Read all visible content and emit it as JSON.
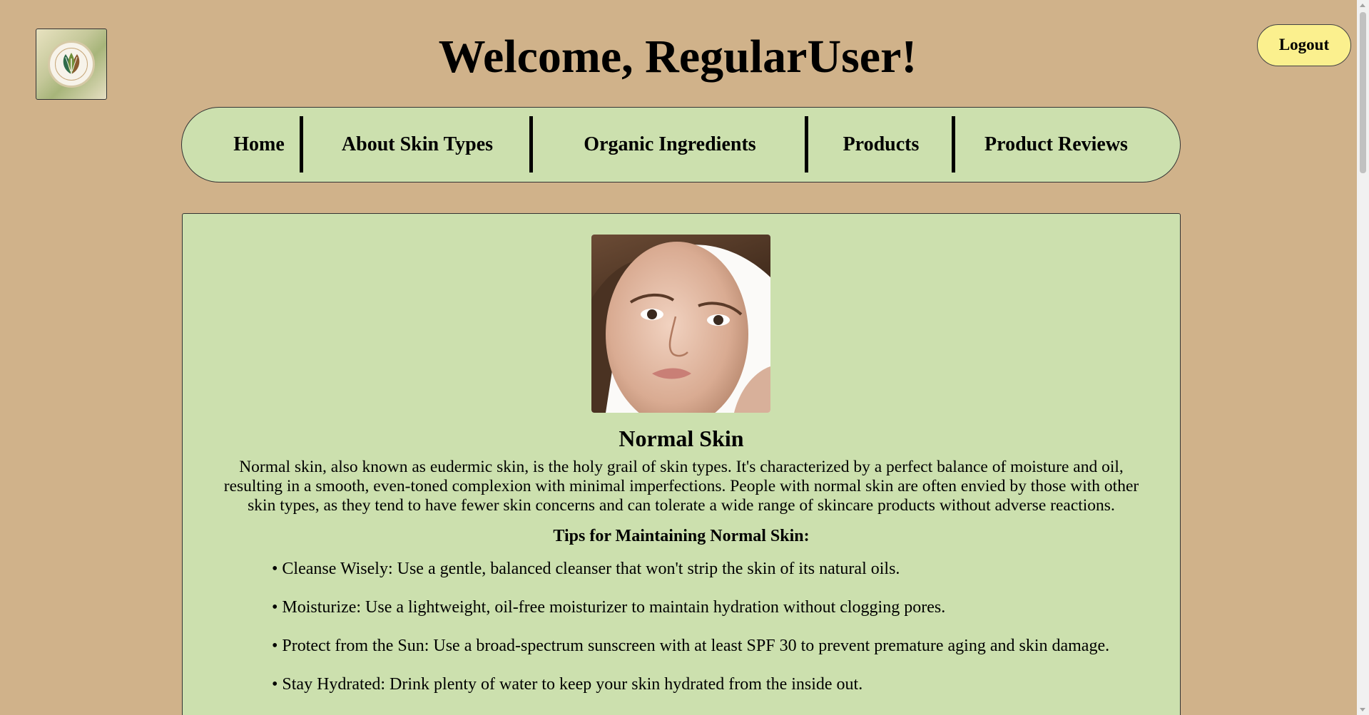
{
  "header": {
    "welcome": "Welcome, RegularUser!",
    "logout_label": "Logout",
    "logo_icon": "leaf-logo-icon"
  },
  "nav": {
    "items": [
      {
        "label": "Home"
      },
      {
        "label": "About Skin Types"
      },
      {
        "label": "Organic Ingredients"
      },
      {
        "label": "Products"
      },
      {
        "label": "Product Reviews"
      }
    ]
  },
  "article": {
    "image_icon": "face-photo",
    "title": "Normal Skin",
    "description": "Normal skin, also known as eudermic skin, is the holy grail of skin types. It's characterized by a perfect balance of moisture and oil, resulting in a smooth, even-toned complexion with minimal imperfections. People with normal skin are often envied by those with other skin types, as they tend to have fewer skin concerns and can tolerate a wide range of skincare products without adverse reactions.",
    "tips_title": "Tips for Maintaining Normal Skin:",
    "tips": [
      "• Cleanse Wisely: Use a gentle, balanced cleanser that won't strip the skin of its natural oils.",
      "• Moisturize: Use a lightweight, oil-free moisturizer to maintain hydration without clogging pores.",
      "• Protect from the Sun: Use a broad-spectrum sunscreen with at least SPF 30 to prevent premature aging and skin damage.",
      "• Stay Hydrated: Drink plenty of water to keep your skin hydrated from the inside out."
    ]
  },
  "colors": {
    "background": "#d0b28a",
    "panel": "#cce0ae",
    "logout_button": "#fbf08e"
  }
}
